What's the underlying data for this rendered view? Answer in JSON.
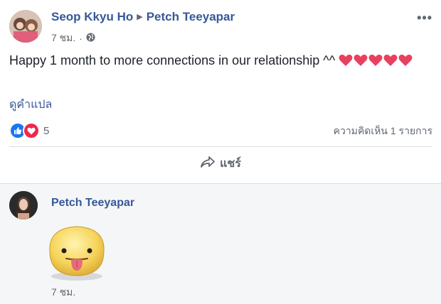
{
  "post": {
    "author": "Seop Kkyu Ho",
    "target": "Petch Teeyapar",
    "time": "7 ชม.",
    "separator": "·",
    "text": "Happy 1 month to more connections in our relationship ^^",
    "hearts": 5,
    "translate_link": "ดูคำแปล",
    "reaction_count": "5",
    "comments_count": "ความคิดเห็น 1 รายการ",
    "share_label": "แชร์"
  },
  "comment": {
    "author": "Petch Teeyapar",
    "time": "7 ชม."
  },
  "colors": {
    "link": "#365899",
    "like_blue": "#1877f2",
    "love_red": "#f0284a",
    "heart": "#e8415f",
    "sticker_yellow": "#f6d45a"
  },
  "icons": [
    "globe-icon",
    "more-icon",
    "like-icon",
    "love-icon",
    "heart-emoji-icon",
    "share-icon",
    "sticker-icon"
  ]
}
